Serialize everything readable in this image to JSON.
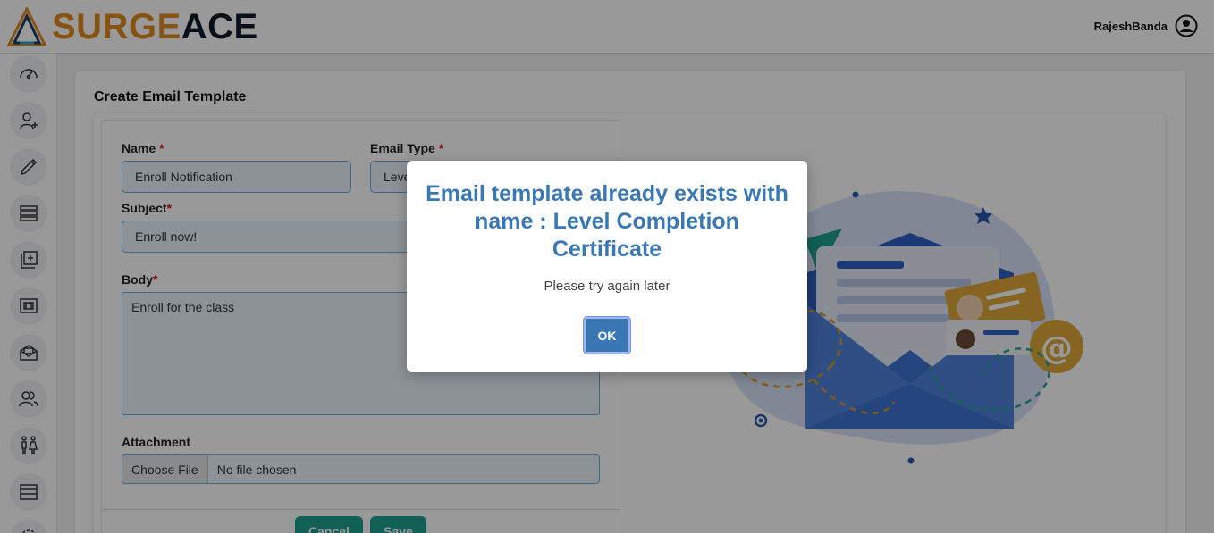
{
  "app": {
    "logo_part1": "SURGE",
    "logo_part2": "ACE"
  },
  "header": {
    "username": "RajeshBanda",
    "user_icon": "user-circle-icon"
  },
  "sidebar": {
    "items": [
      {
        "icon": "dashboard-gauge-icon"
      },
      {
        "icon": "add-user-icon"
      },
      {
        "icon": "pen-icon"
      },
      {
        "icon": "layers-icon"
      },
      {
        "icon": "add-content-icon"
      },
      {
        "icon": "media-frame-icon"
      },
      {
        "icon": "envelope-open-icon"
      },
      {
        "icon": "users-icon"
      },
      {
        "icon": "people-pair-icon"
      },
      {
        "icon": "list-rows-icon"
      },
      {
        "icon": "settings-icon"
      }
    ]
  },
  "page": {
    "title": "Create Email Template"
  },
  "form": {
    "name_label": "Name",
    "name_value": "Enroll Notification",
    "email_type_label": "Email Type",
    "email_type_value": "Leve",
    "subject_label": "Subject",
    "subject_value": "Enroll now!",
    "body_label": "Body",
    "body_value": "Enroll for the class",
    "attachment_label": "Attachment",
    "file_button": "Choose File",
    "file_status": "No file chosen",
    "required_marker": "*",
    "cancel_label": "Cancel",
    "save_label": "Save"
  },
  "modal": {
    "title": "Email template already exists with name : Level Completion Certificate",
    "message": "Please try again later",
    "ok_label": "OK"
  },
  "colors": {
    "brand_orange": "#e08a1e",
    "brand_dark": "#0d1b2a",
    "modal_title": "#3a78b5",
    "button_teal": "#1f9e8f",
    "input_border": "#6aaed6",
    "required": "#dd1111"
  }
}
